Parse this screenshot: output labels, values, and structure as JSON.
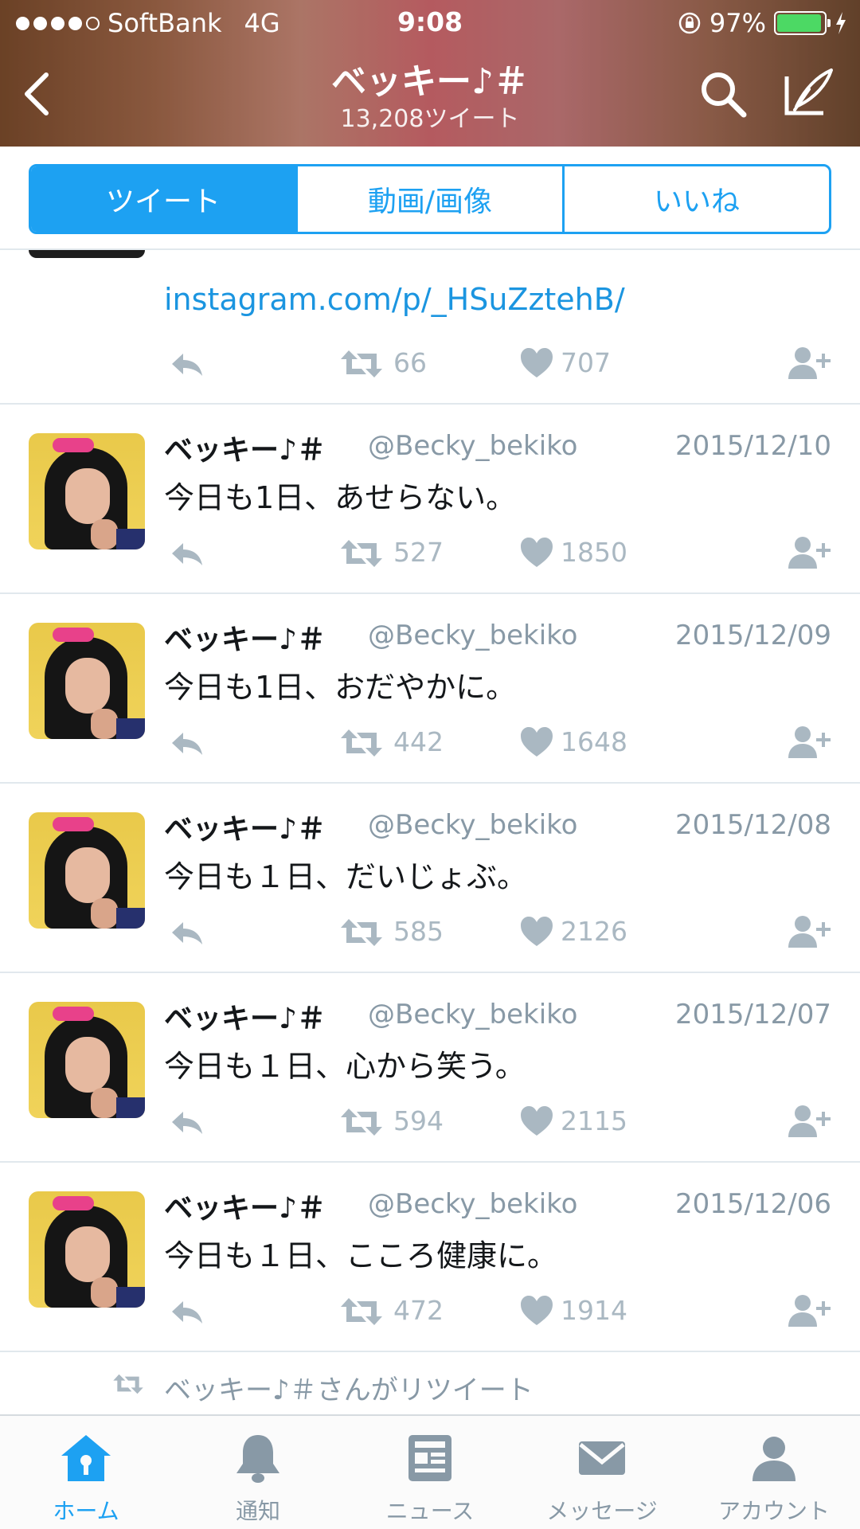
{
  "status_bar": {
    "carrier": "SoftBank",
    "network": "4G",
    "time": "9:08",
    "battery": "97%"
  },
  "nav": {
    "title": "ベッキー♪＃",
    "subtitle": "13,208ツイート"
  },
  "segments": [
    {
      "label": "ツイート",
      "active": true
    },
    {
      "label": "動画/画像",
      "active": false
    },
    {
      "label": "いいね",
      "active": false
    }
  ],
  "partial_tweet": {
    "link": "instagram.com/p/_HSuZztehB/",
    "retweets": "66",
    "likes": "707"
  },
  "tweets": [
    {
      "name": "ベッキー♪＃",
      "handle": "@Becky_bekiko",
      "date": "2015/12/10",
      "text": "今日も1日、あせらない。",
      "retweets": "527",
      "likes": "1850"
    },
    {
      "name": "ベッキー♪＃",
      "handle": "@Becky_bekiko",
      "date": "2015/12/09",
      "text": "今日も1日、おだやかに。",
      "retweets": "442",
      "likes": "1648"
    },
    {
      "name": "ベッキー♪＃",
      "handle": "@Becky_bekiko",
      "date": "2015/12/08",
      "text": "今日も１日、だいじょぶ。",
      "retweets": "585",
      "likes": "2126"
    },
    {
      "name": "ベッキー♪＃",
      "handle": "@Becky_bekiko",
      "date": "2015/12/07",
      "text": "今日も１日、心から笑う。",
      "retweets": "594",
      "likes": "2115"
    },
    {
      "name": "ベッキー♪＃",
      "handle": "@Becky_bekiko",
      "date": "2015/12/06",
      "text": "今日も１日、こころ健康に。",
      "retweets": "472",
      "likes": "1914"
    }
  ],
  "retweet_note": "ベッキー♪＃さんがリツイート",
  "tabbar": [
    {
      "label": "ホーム",
      "icon": "home-icon",
      "active": true
    },
    {
      "label": "通知",
      "icon": "bell-icon",
      "active": false
    },
    {
      "label": "ニュース",
      "icon": "news-icon",
      "active": false
    },
    {
      "label": "メッセージ",
      "icon": "envelope-icon",
      "active": false
    },
    {
      "label": "アカウント",
      "icon": "person-icon",
      "active": false
    }
  ],
  "colors": {
    "accent": "#1da1f2",
    "link": "#1b95e0",
    "muted": "#8899a6",
    "action_gray": "#aab8c2",
    "battery_green": "#4cd964"
  }
}
